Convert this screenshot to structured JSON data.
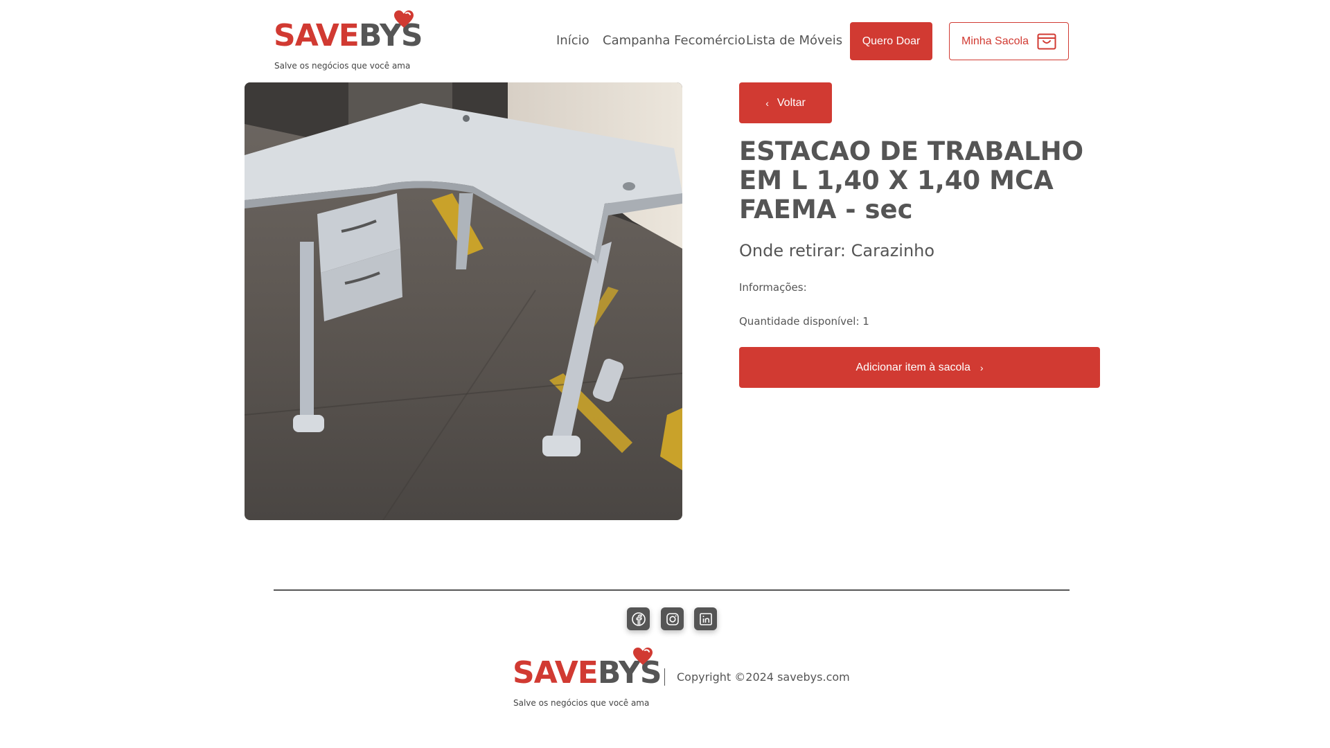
{
  "brand": {
    "name_part1": "SAVE",
    "name_part2": "BYS",
    "tagline": "Salve os negócios que você ama",
    "accent_color": "#d13a32",
    "text_color": "#555555"
  },
  "nav": {
    "items": [
      {
        "label": "Início"
      },
      {
        "label": "Campanha Fecomércio"
      },
      {
        "label": "Lista de Móveis"
      }
    ],
    "donate_label": "Quero Doar",
    "bag_label": "Minha Sacola",
    "bag_icon": "shopping-bag-icon"
  },
  "product": {
    "back_label": "Voltar",
    "back_icon": "chevron-left-icon",
    "title": "ESTACAO DE TRABALHO EM L 1,40 X 1,40 MCA FAEMA - sec",
    "pickup_label": "Onde retirar: ",
    "pickup_city": "Carazinho",
    "info_label": "Informações:",
    "quantity_label": "Quantidade disponível: ",
    "quantity_value": "1",
    "add_label": "Adicionar item à sacola",
    "add_icon": "chevron-right-icon",
    "image_icon": "l-shaped-desk-photo"
  },
  "footer": {
    "social": [
      {
        "icon": "facebook-icon"
      },
      {
        "icon": "instagram-icon"
      },
      {
        "icon": "linkedin-icon"
      }
    ],
    "copyright": "Copyright ©2024 savebys.com"
  }
}
